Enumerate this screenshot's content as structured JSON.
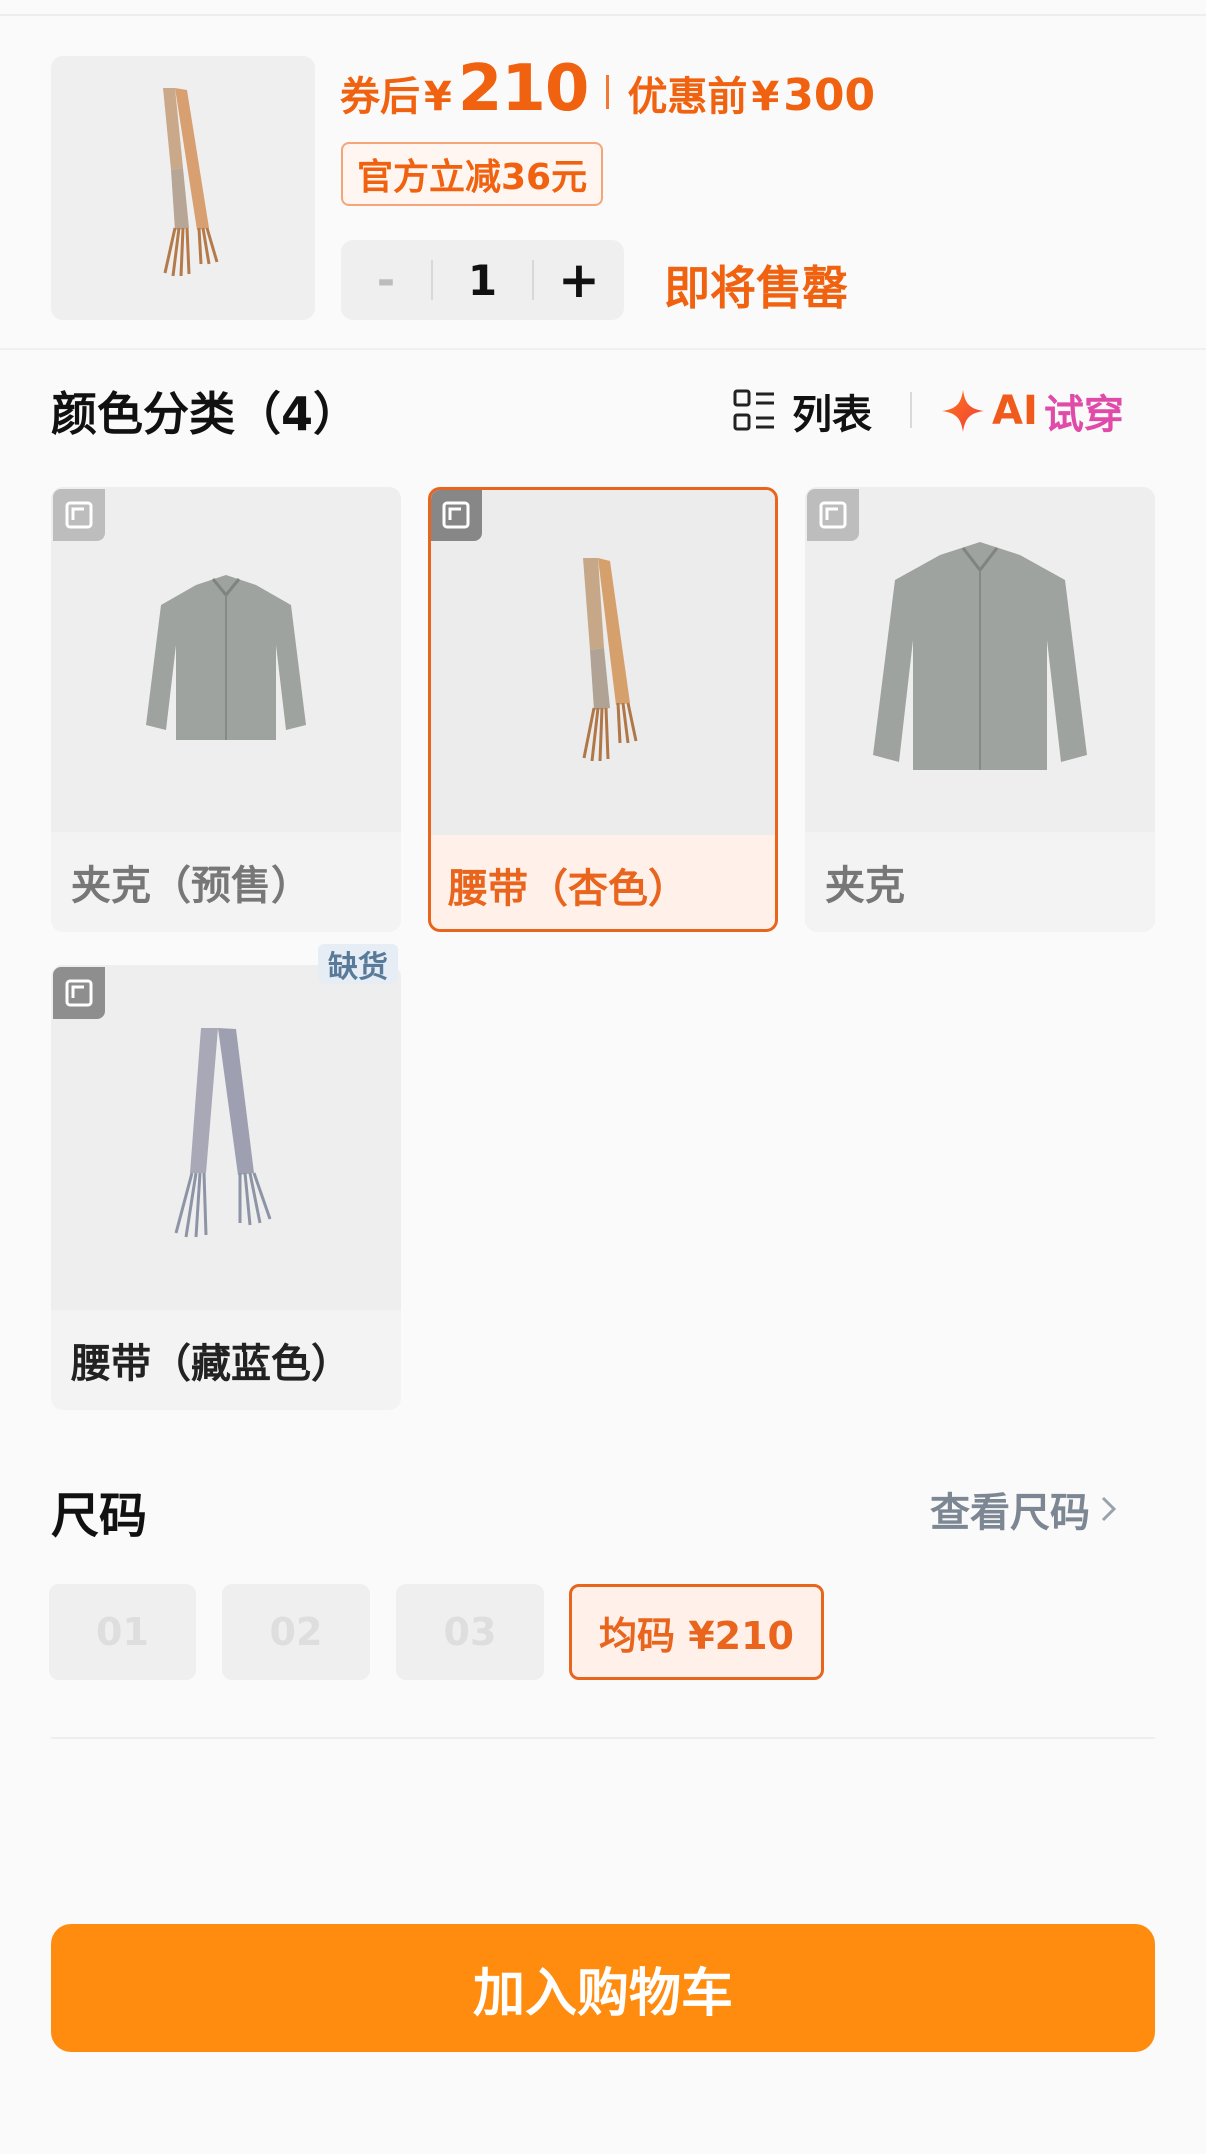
{
  "header": {
    "price_prefix": "券后",
    "currency": "¥",
    "price_after": "210",
    "price_before_label": "优惠前",
    "price_before": "300",
    "coupon_tag": "官方立减36元",
    "quantity": "1",
    "minus": "-",
    "plus": "+",
    "stock_status": "即将售罄"
  },
  "colors": {
    "title": "颜色分类（4）",
    "list_label": "列表",
    "ai_label": "AI",
    "ai_try_label": "试穿",
    "items": [
      {
        "label": "夹克（预售）",
        "selected": false
      },
      {
        "label": "腰带（杏色）",
        "selected": true
      },
      {
        "label": "夹克",
        "selected": false
      },
      {
        "label": "腰带（藏蓝色）",
        "selected": false,
        "badge": "缺货"
      }
    ]
  },
  "sizes": {
    "title": "尺码",
    "guide_label": "查看尺码",
    "options": [
      {
        "label": "01",
        "available": false
      },
      {
        "label": "02",
        "available": false
      },
      {
        "label": "03",
        "available": false
      },
      {
        "label": "均码  ¥210",
        "available": true,
        "selected": true
      }
    ]
  },
  "cta": {
    "add_to_cart": "加入购物车"
  },
  "theme": {
    "accent": "#f0620f",
    "cta_bg": "#ff8c0f",
    "ai_pink": "#e04aa8"
  }
}
